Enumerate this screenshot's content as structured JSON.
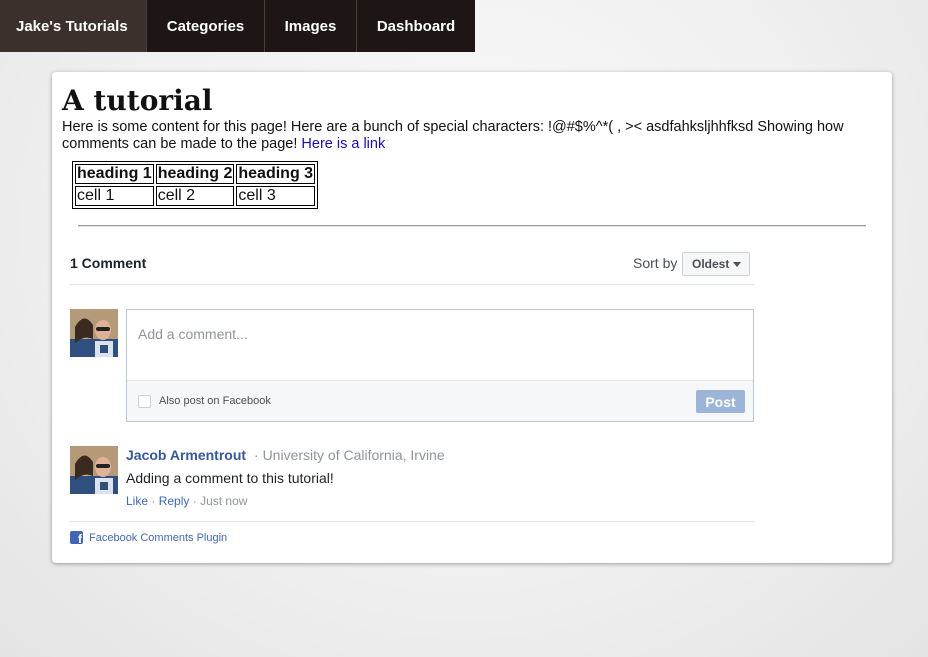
{
  "nav": {
    "brand": "Jake's Tutorials",
    "items": [
      {
        "label": "Categories"
      },
      {
        "label": "Images"
      },
      {
        "label": "Dashboard"
      }
    ]
  },
  "page": {
    "title": "A tutorial",
    "content": "Here is some content for this page! Here are a bunch of special characters: !@#$%^*( , >< asdfahksljhhfksd Showing how comments can be made to the page!",
    "link_text": "Here is a link"
  },
  "table": {
    "headers": [
      "heading 1",
      "heading 2",
      "heading 3"
    ],
    "rows": [
      [
        "cell 1",
        "cell 2",
        "cell 3"
      ]
    ]
  },
  "comments": {
    "count_label": "1 Comment",
    "sort_label": "Sort by",
    "sort_value": "Oldest",
    "input_placeholder": "Add a comment...",
    "also_post_label": "Also post on Facebook",
    "post_button": "Post",
    "list": [
      {
        "author": "Jacob Armentrout",
        "separator": "·",
        "affiliation": "University of California, Irvine",
        "text": "Adding a comment to this tutorial!",
        "like_label": "Like",
        "reply_label": "Reply",
        "timestamp": "Just now"
      }
    ],
    "plugin_label": "Facebook Comments Plugin"
  },
  "icons": {
    "facebook": "facebook-icon",
    "caret": "caret-down-icon"
  },
  "colors": {
    "nav_bg": "#1d1614",
    "nav_brand_bg": "#3b302b",
    "link": "#1a0dab",
    "fb_blue": "#4267b2",
    "author": "#365899",
    "post_button": "#9cb4d8"
  }
}
